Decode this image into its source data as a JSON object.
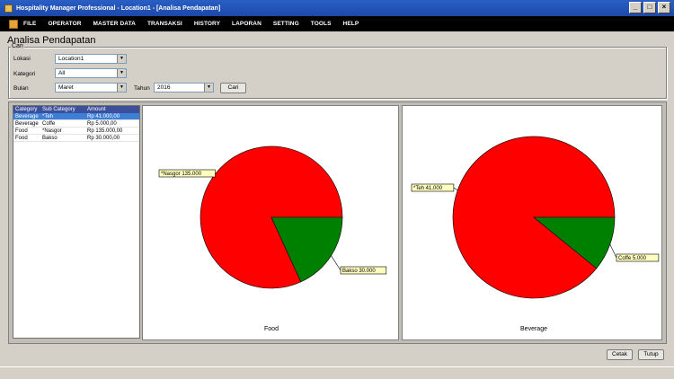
{
  "window": {
    "title": "Hospitality Manager Professional - Location1 - [Analisa Pendapatan]"
  },
  "menu": [
    "FILE",
    "OPERATOR",
    "MASTER DATA",
    "TRANSAKSI",
    "HISTORY",
    "LAPORAN",
    "SETTING",
    "TOOLS",
    "HELP"
  ],
  "page": {
    "title": "Analisa Pendapatan"
  },
  "filter": {
    "legend": "Cari",
    "lokasi_label": "Lokasi",
    "lokasi_value": "Location1",
    "kategori_label": "Kategori",
    "kategori_value": "All",
    "bulan_label": "Bulan",
    "bulan_value": "Maret",
    "tahun_label": "Tahun",
    "tahun_value": "2016",
    "search_button": "Cari"
  },
  "table": {
    "columns": [
      "Category",
      "Sub Category",
      "Amount"
    ],
    "rows": [
      [
        "Beverage",
        "*Teh",
        "Rp 41.000,00"
      ],
      [
        "Beverage",
        "Coffe",
        "Rp 5.000,00"
      ],
      [
        "Food",
        "*Nasgor",
        "Rp 135.000,00"
      ],
      [
        "Food",
        "Bakso",
        "Rp 30.000,00"
      ]
    ]
  },
  "chart_data": [
    {
      "type": "pie",
      "title": "Food",
      "categories": [
        "*Nasgor",
        "Bakso"
      ],
      "values": [
        135000,
        30000
      ],
      "labels": [
        "*Nasgor 135.000",
        "Bakso 30.000"
      ],
      "colors": [
        "#ff0000",
        "#008000"
      ]
    },
    {
      "type": "pie",
      "title": "Beverage",
      "categories": [
        "*Teh",
        "Coffe"
      ],
      "values": [
        41000,
        5000
      ],
      "labels": [
        "*Teh 41.000",
        "Coffe 5.000"
      ],
      "colors": [
        "#ff0000",
        "#008000"
      ]
    }
  ],
  "actions": {
    "print": "Cetak",
    "close": "Tutup"
  }
}
